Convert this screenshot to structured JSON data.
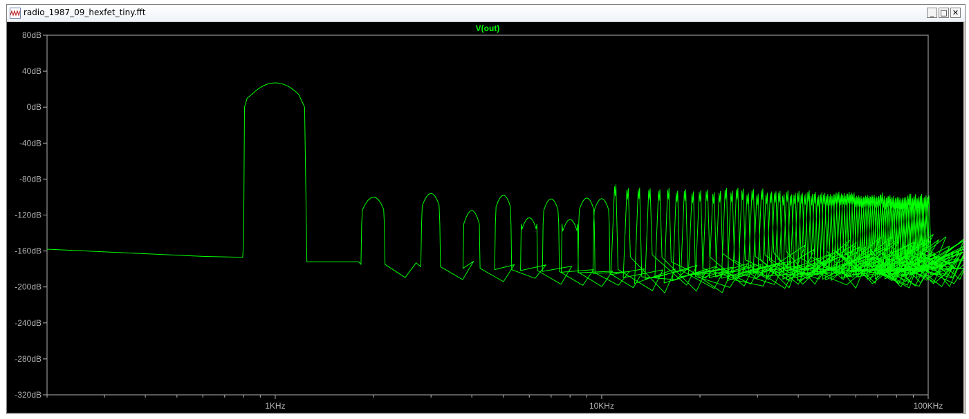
{
  "window": {
    "title": "radio_1987_09_hexfet_tiny.fft",
    "minimize_label": "_",
    "maximize_label": "□",
    "close_label": "✕",
    "icon": "waveform-icon"
  },
  "colors": {
    "trace": "#00ff00",
    "background": "#000000",
    "frame": "#b4b4b4",
    "tick_text": "#b4b4b4"
  },
  "chart_data": {
    "type": "line",
    "title": "V(out)",
    "xlabel": "",
    "ylabel": "",
    "x_scale": "log",
    "xlim": [
      200,
      100000
    ],
    "ylim": [
      -320,
      80
    ],
    "y_ticks": [
      80,
      40,
      0,
      -40,
      -80,
      -120,
      -160,
      -200,
      -240,
      -280,
      -320
    ],
    "y_tick_labels": [
      "80dB",
      "40dB",
      "0dB",
      "-40dB",
      "-80dB",
      "-120dB",
      "-160dB",
      "-200dB",
      "-240dB",
      "-280dB",
      "-320dB"
    ],
    "x_ticks": [
      1000,
      10000,
      100000
    ],
    "x_tick_labels": [
      "1KHz",
      "10KHz",
      "100KHz"
    ],
    "grid": false,
    "series": [
      {
        "name": "V(out)",
        "noise_floor": [
          [
            200,
            -158
          ],
          [
            600,
            -166
          ],
          [
            800,
            -167
          ],
          [
            1200,
            -172
          ],
          [
            1800,
            -172
          ],
          [
            2000,
            -175
          ],
          [
            10000,
            -185
          ],
          [
            100000,
            -175
          ]
        ],
        "fundamental": {
          "freq": 1000,
          "db": 27,
          "left_edge": 800,
          "right_edge": 1250
        },
        "harmonics": [
          {
            "freq": 2000,
            "db": -100
          },
          {
            "freq": 3000,
            "db": -96
          },
          {
            "freq": 4000,
            "db": -115
          },
          {
            "freq": 5000,
            "db": -98
          },
          {
            "freq": 6000,
            "db": -123
          },
          {
            "freq": 7000,
            "db": -102
          },
          {
            "freq": 8000,
            "db": -125
          },
          {
            "freq": 9000,
            "db": -101
          }
        ],
        "harmonic_tail_db_range": [
          -100,
          -112
        ]
      }
    ]
  }
}
